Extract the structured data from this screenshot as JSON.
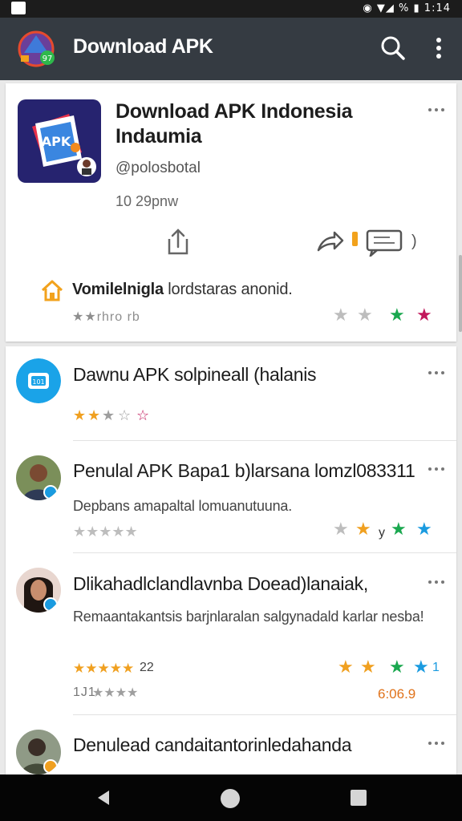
{
  "status_bar": {
    "time": "1:14",
    "battery": "%"
  },
  "app_bar": {
    "title": "Download APK"
  },
  "hero": {
    "title": "Download APK Indonesia Indaumia",
    "handle": "@polosbotal",
    "time": "10 29pnw",
    "promo_bold": "Vomilelnigla",
    "promo_rest": " lordstaras anonid.",
    "rating_label": "★★rhro rb"
  },
  "items": [
    {
      "title": "Dawnu APK solpineall (halanis",
      "subtitle": "",
      "rating_left": "",
      "rating_right": ""
    },
    {
      "title": "Penulal APK Bapa1 b)larsana lomzl083311",
      "subtitle": "Depbans amapaltal lomuanutuuna.",
      "rating_left": "",
      "rating_right": "y"
    },
    {
      "title": "Dlikahadlclandlavnba Doead)lanaiak,",
      "subtitle": "Remaantakantsis barjnlaralan salgynadald karlar nesba!",
      "rating_left": "22",
      "rating_left2": "1J1",
      "rating_right": "6:06.9",
      "rating_right_top": "1"
    },
    {
      "title": "Denulead candaitantorinledahanda",
      "subtitle": ""
    }
  ],
  "colors": {
    "app_bar": "#353b42",
    "star_orange": "#f0a020",
    "star_green": "#1aa84f",
    "star_blue": "#1a9be0",
    "star_red": "#c2185b"
  }
}
